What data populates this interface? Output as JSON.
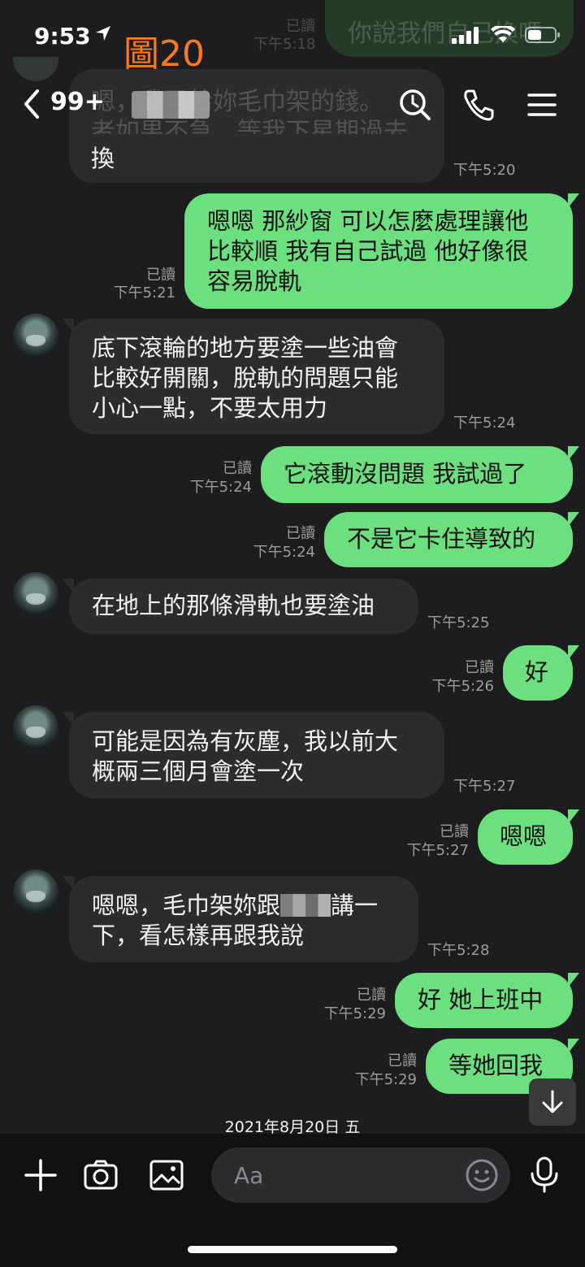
{
  "status": {
    "time": "9:53"
  },
  "overlay_label": "圖20",
  "header": {
    "unread": "99+"
  },
  "ghost": {
    "top_bubble": "你說我們自己換嗎",
    "top_time": "下午5:18",
    "read_top": "已讀",
    "line1": "嗯，我再給妳毛巾架的錢。",
    "line2": "者如果不急，等我下星期過去"
  },
  "messages": [
    {
      "dir": "in",
      "text": "換",
      "time": "下午5:20"
    },
    {
      "dir": "out",
      "text": "嗯嗯 那紗窗 可以怎麼處理讓他\n比較順 我有自己試過 他好像很\n容易脫軌",
      "read": "已讀",
      "time": "下午5:21"
    },
    {
      "dir": "in",
      "text": "底下滾輪的地方要塗一些油會\n比較好開關，脫軌的問題只能\n小心一點，不要太用力",
      "time": "下午5:24"
    },
    {
      "dir": "out",
      "text": "它滾動沒問題 我試過了",
      "read": "已讀",
      "time": "下午5:24"
    },
    {
      "dir": "out",
      "text": "不是它卡住導致的",
      "read": "已讀",
      "time": "下午5:24"
    },
    {
      "dir": "in",
      "text": "在地上的那條滑軌也要塗油",
      "time": "下午5:25"
    },
    {
      "dir": "out",
      "text": "好",
      "read": "已讀",
      "time": "下午5:26"
    },
    {
      "dir": "in",
      "text": "可能是因為有灰塵，我以前大\n概兩三個月會塗一次",
      "time": "下午5:27"
    },
    {
      "dir": "out",
      "text": "嗯嗯",
      "read": "已讀",
      "time": "下午5:27"
    },
    {
      "dir": "in",
      "text_a": "嗯嗯，毛巾架妳跟",
      "text_b": "講一",
      "text_c": "下，看怎樣再跟我說",
      "time": "下午5:28"
    },
    {
      "dir": "out",
      "text": "好 她上班中",
      "read": "已讀",
      "time": "下午5:29"
    },
    {
      "dir": "out",
      "text": "等她回我",
      "read": "已讀",
      "time": "下午5:29"
    }
  ],
  "date_divider": "2021年8月20日 五",
  "input": {
    "placeholder": "Aa"
  }
}
